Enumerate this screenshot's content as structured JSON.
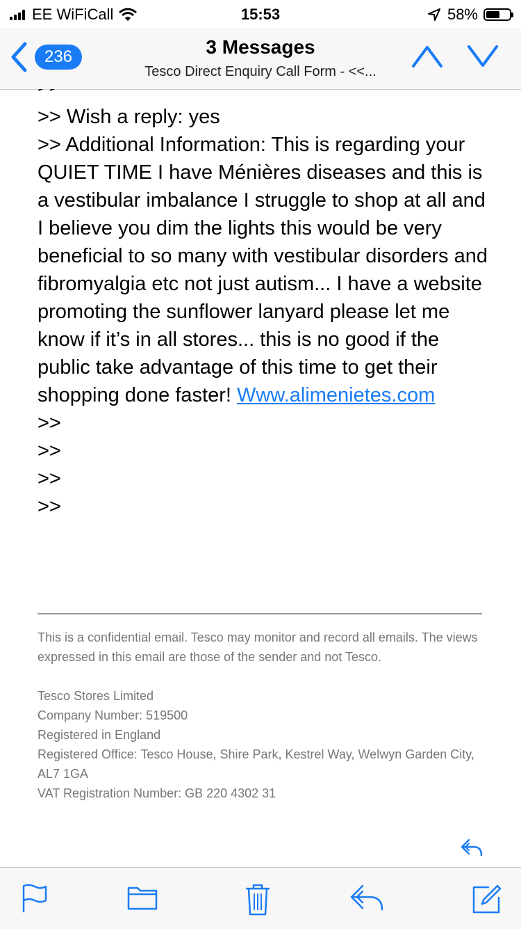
{
  "status_bar": {
    "carrier": "EE WiFiCall",
    "time": "15:53",
    "battery_percent": "58%",
    "battery_level": 0.58,
    "icons": [
      "signal-icon",
      "wifi-icon",
      "location-arrow-icon",
      "battery-icon"
    ]
  },
  "nav": {
    "back_count": "236",
    "title": "3 Messages",
    "subtitle": "Tesco Direct Enquiry Call Form -  <<...",
    "icons": [
      "back-chevron-icon",
      "up-arrow-icon",
      "down-arrow-icon"
    ]
  },
  "message": {
    "cut_line": ">>",
    "wish_reply": ">> Wish a reply: yes",
    "additional_info": ">> Additional Information: This is regarding your QUIET TIME I have Ménières diseases and this is a vestibular imbalance I struggle to shop at all and I believe you dim the lights this would be very beneficial to so many with vestibular disorders and fibromyalgia etc not just autism... I have a website promoting the sunflower lanyard please let me know if it’s in all stores... this is no good if the public take advantage of this time to get their shopping done faster! ",
    "link_text": "Www.alimenietes.com",
    "quote_lines": [
      ">>",
      ">>",
      ">>",
      ">>"
    ]
  },
  "disclaimer": {
    "confidential": "This is a confidential email. Tesco may monitor and record all emails. The views expressed in this email are those of the sender and not Tesco.",
    "company": "Tesco Stores Limited",
    "company_number": "Company Number: 519500",
    "registered": "Registered in England",
    "office": "Registered Office: Tesco House, Shire Park, Kestrel Way, Welwyn Garden City, AL7 1GA",
    "vat": "VAT Registration Number: GB 220 4302 31"
  },
  "toolbar": {
    "icons": [
      "flag-icon",
      "folder-icon",
      "trash-icon",
      "reply-icon",
      "compose-icon"
    ]
  },
  "colors": {
    "accent": "#1a7cf5",
    "bar_background": "#f7f7f7",
    "disclaimer_text": "#777777"
  }
}
